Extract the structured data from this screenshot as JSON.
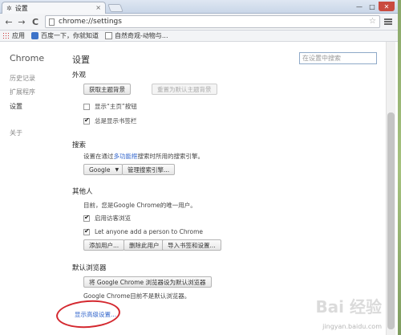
{
  "tab": {
    "title": "设置",
    "icon": "gear-icon",
    "close": "×"
  },
  "window_controls": {
    "minimize": "—",
    "maximize": "□",
    "close": "✕"
  },
  "toolbar": {
    "url": "chrome://settings",
    "back": "←",
    "forward": "→",
    "reload": "C",
    "star": "☆"
  },
  "bookmarks": [
    {
      "label": "应用",
      "icon": "apps-icon"
    },
    {
      "label": "百度一下，你就知道",
      "icon": "ie-icon"
    },
    {
      "label": "自然奇观-动物与...",
      "icon": "doc-icon"
    }
  ],
  "sidebar": {
    "title": "Chrome",
    "items": [
      {
        "label": "历史记录"
      },
      {
        "label": "扩展程序"
      },
      {
        "label": "设置"
      },
      {
        "label": "关于"
      }
    ]
  },
  "main": {
    "title": "设置",
    "search_placeholder": "在设置中搜索",
    "appearance": {
      "heading": "外观",
      "get_theme": "获取主题背景",
      "reset_theme": "重置为默认主题背景",
      "show_home": "显示“主页”按钮",
      "show_bookmarks": "总是显示书签栏"
    },
    "search": {
      "heading": "搜索",
      "desc_prefix": "设置在通过",
      "desc_link": "多功能框",
      "desc_suffix": "搜索时所用的搜索引擎。",
      "engine": "Google",
      "manage": "管理搜索引擎..."
    },
    "people": {
      "heading": "其他人",
      "current": "目前，您是Google Chrome的唯一用户。",
      "guest": "启用访客浏览",
      "anyone_add": "Let anyone add a person to Chrome",
      "add_user": "添加用户...",
      "remove_user": "删除此用户",
      "import": "导入书签和设置..."
    },
    "default_browser": {
      "heading": "默认浏览器",
      "set_default": "将 Google Chrome 浏览器设为默认浏览器",
      "status": "Google Chrome目前不是默认浏览器。"
    },
    "show_advanced": "显示高级设置..."
  },
  "watermark": {
    "main": "Bai 经验",
    "sub": "jingyan.baidu.com"
  }
}
